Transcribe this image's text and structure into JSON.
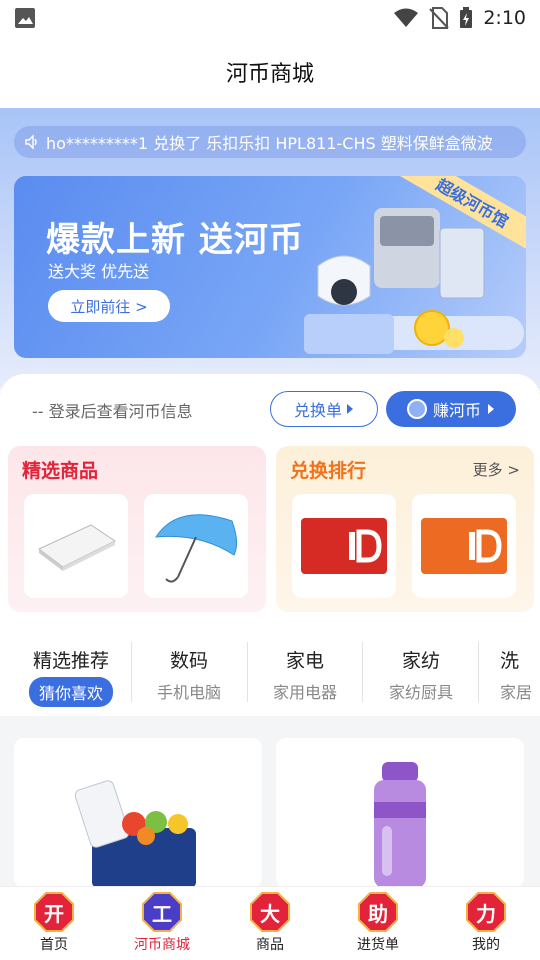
{
  "status_bar": {
    "time": "2:10"
  },
  "header": {
    "title": "河币商城"
  },
  "ticker": {
    "text": "ho*********1 兑换了 乐扣乐扣 HPL811-CHS 塑料保鲜盒微波"
  },
  "banner": {
    "title": "爆款上新 送河币",
    "subtitle": "送大奖 优先送",
    "button_label": "立即前往 >",
    "ribbon_text": "超级河币馆"
  },
  "account": {
    "login_hint": "-- 登录后查看河币信息",
    "exchange_orders_label": "兑换单",
    "earn_coins_label": "赚河币"
  },
  "featured": {
    "title": "精选商品"
  },
  "ranking": {
    "title": "兑换排行",
    "more_label": "更多 >"
  },
  "categories": [
    {
      "name": "精选推荐",
      "sub": "猜你喜欢"
    },
    {
      "name": "数码",
      "sub": "手机电脑"
    },
    {
      "name": "家电",
      "sub": "家用电器"
    },
    {
      "name": "家纺",
      "sub": "家纺厨具"
    },
    {
      "name": "洗",
      "sub": "家居"
    }
  ],
  "tabs": [
    {
      "badge": "开",
      "label": "首页"
    },
    {
      "badge": "工",
      "label": "河币商城"
    },
    {
      "badge": "大",
      "label": "商品"
    },
    {
      "badge": "助",
      "label": "进货单"
    },
    {
      "badge": "力",
      "label": "我的"
    }
  ],
  "colors": {
    "accent": "#3b6fe0",
    "red": "#e2233a",
    "orange": "#f0731b"
  }
}
